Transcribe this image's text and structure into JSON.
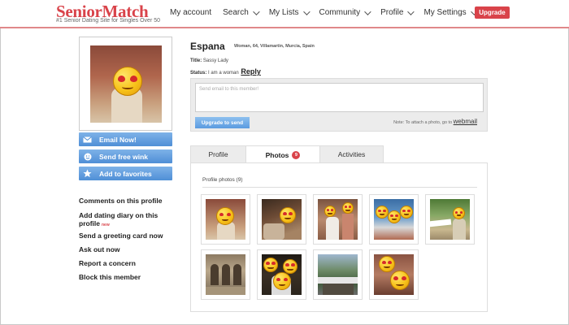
{
  "header": {
    "logo": "SeniorMatch",
    "tagline": "#1 Senior Dating Site for Singles Over 50",
    "nav": [
      {
        "label": "My account",
        "has_caret": false
      },
      {
        "label": "Search",
        "has_caret": true
      },
      {
        "label": "My Lists",
        "has_caret": true
      },
      {
        "label": "Community",
        "has_caret": true
      },
      {
        "label": "Profile",
        "has_caret": true
      },
      {
        "label": "My Settings",
        "has_caret": true
      }
    ],
    "upgrade_label": "Upgrade"
  },
  "sidebar": {
    "buttons": [
      {
        "label": "Email Now!",
        "icon": "envelope-icon"
      },
      {
        "label": "Send free wink",
        "icon": "wink-icon"
      },
      {
        "label": "Add to favorites",
        "icon": "star-icon"
      }
    ],
    "links": [
      {
        "label": "Comments on this profile"
      },
      {
        "label": "Add dating diary on this",
        "label2": "profile",
        "tag": "new"
      },
      {
        "label": "Send a greeting card now"
      },
      {
        "label": "Ask out now"
      },
      {
        "label": "Report a concern"
      },
      {
        "label": "Block this member"
      }
    ]
  },
  "profile": {
    "name": "Espana",
    "meta": "Woman, 64, Villamartin, Murcia, Spain",
    "title_label": "Title:",
    "title_value": "Sassy Lady",
    "status_label": "Status:",
    "status_value": "I am a woman",
    "reply_label": "Reply"
  },
  "email": {
    "placeholder": "Send email to this member!",
    "send_label": "Upgrade to send",
    "note": "Note: To attach a photo, go to",
    "webmail": "webmail"
  },
  "tabs": [
    {
      "label": "Profile",
      "active": false
    },
    {
      "label": "Photos",
      "active": true,
      "badge": "9"
    },
    {
      "label": "Activities",
      "active": false
    }
  ],
  "photos": {
    "title": "Profile photos (9)",
    "count": 9
  },
  "colors": {
    "brand": "#d9434a",
    "button_blue": "#4f8fd6"
  }
}
